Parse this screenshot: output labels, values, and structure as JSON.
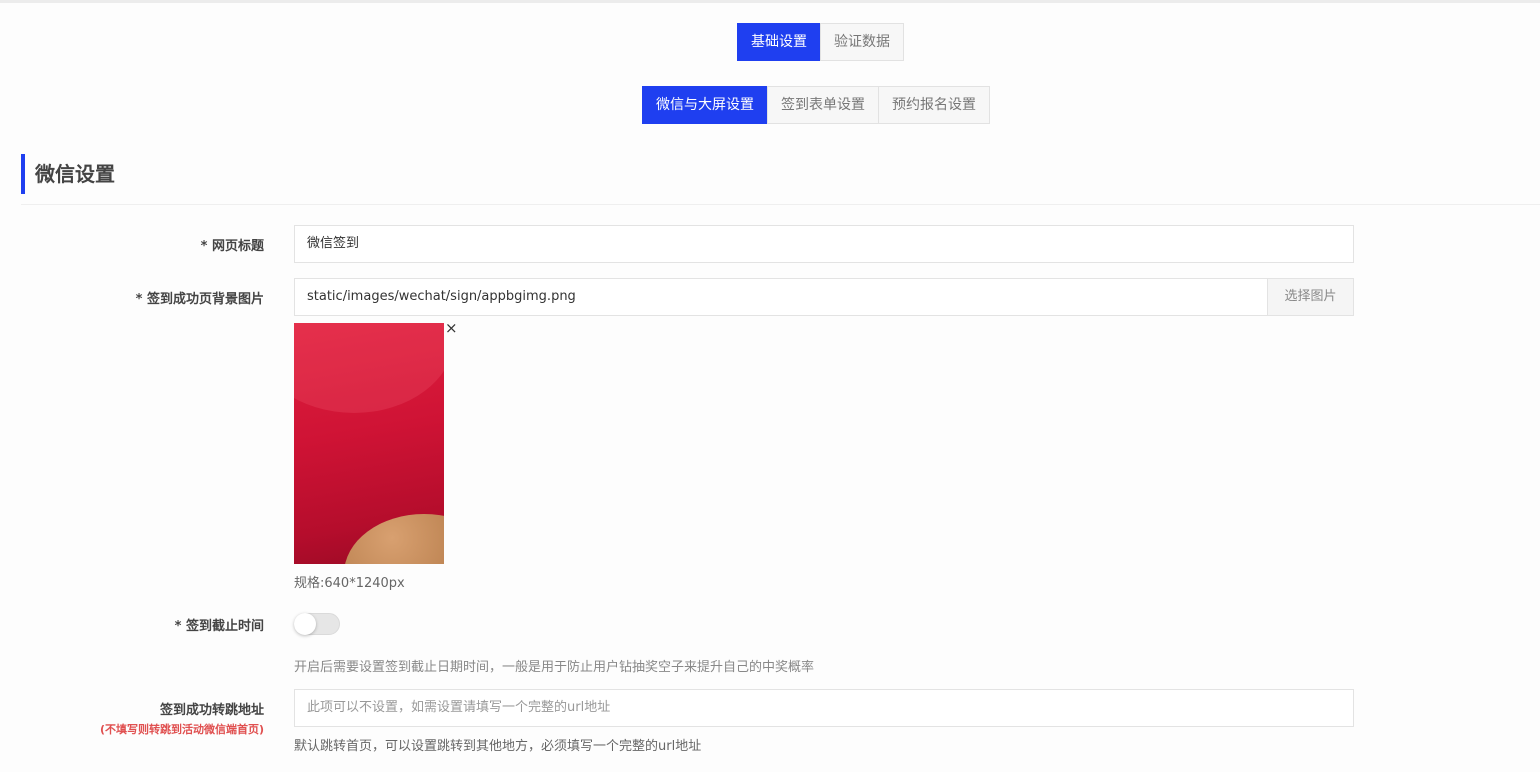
{
  "tabs_main": [
    {
      "label": "基础设置",
      "active": true
    },
    {
      "label": "验证数据",
      "active": false
    }
  ],
  "tabs_sub": [
    {
      "label": "微信与大屏设置",
      "active": true
    },
    {
      "label": "签到表单设置",
      "active": false
    },
    {
      "label": "预约报名设置",
      "active": false
    }
  ],
  "section": {
    "title": "微信设置"
  },
  "form": {
    "page_title": {
      "label": "* 网页标题",
      "value": "微信签到"
    },
    "bg_image": {
      "label": "* 签到成功页背景图片",
      "value": "static/images/wechat/sign/appbgimg.png",
      "button": "选择图片",
      "remove": "×",
      "spec": "规格:640*1240px"
    },
    "deadline": {
      "label": "* 签到截止时间",
      "enabled": false,
      "hint": "开启后需要设置签到截止日期时间，一般是用于防止用户钻抽奖空子来提升自己的中奖概率"
    },
    "redirect": {
      "label": "签到成功转跳地址",
      "sublabel": "(不填写则转跳到活动微信端首页)",
      "placeholder": "此项可以不设置，如需设置请填写一个完整的url地址",
      "hint": "默认跳转首页，可以设置跳转到其他地方，必须填写一个完整的url地址"
    }
  },
  "colors": {
    "accent": "#1f3ff0",
    "warning": "#e05050"
  }
}
